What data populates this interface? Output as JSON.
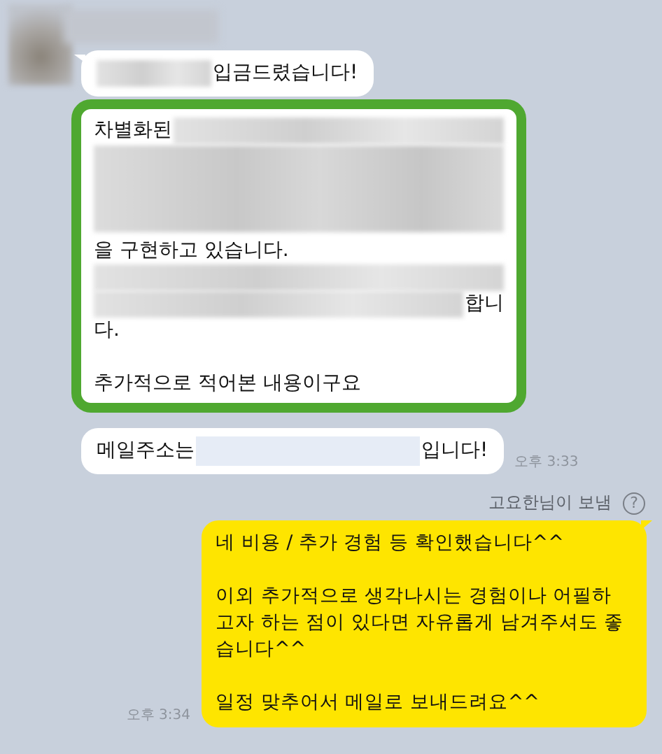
{
  "received": [
    {
      "highlighted": false,
      "lines": [
        {
          "kind": "text",
          "segments": [
            {
              "kind": "redacted"
            },
            {
              "kind": "text",
              "text": "입금드렸습니다!"
            }
          ]
        }
      ]
    },
    {
      "highlighted": true,
      "lines": [
        {
          "kind": "text",
          "segments": [
            {
              "kind": "text",
              "text": "차별화된"
            },
            {
              "kind": "redacted"
            }
          ]
        },
        {
          "kind": "redacted-tall"
        },
        {
          "kind": "text",
          "segments": [
            {
              "kind": "text",
              "text": "을 구현하고 있습니다."
            }
          ]
        },
        {
          "kind": "text",
          "segments": [
            {
              "kind": "redacted"
            }
          ]
        },
        {
          "kind": "text",
          "segments": [
            {
              "kind": "redacted"
            },
            {
              "kind": "text",
              "text": "합니"
            }
          ]
        },
        {
          "kind": "text",
          "segments": [
            {
              "kind": "text",
              "text": "다."
            }
          ]
        },
        {
          "kind": "blank"
        },
        {
          "kind": "text",
          "segments": [
            {
              "kind": "text",
              "text": "추가적으로 적어본 내용이구요"
            }
          ]
        }
      ]
    },
    {
      "highlighted": false,
      "time": "오후 3:33",
      "lines": [
        {
          "kind": "text",
          "segments": [
            {
              "kind": "text",
              "text": "메일주소는"
            },
            {
              "kind": "redacted-link"
            },
            {
              "kind": "text",
              "text": "입니다!"
            }
          ]
        }
      ]
    }
  ],
  "sent_by": {
    "label": "고요한님이 보냄",
    "help_icon": "?"
  },
  "sent": {
    "time": "오후 3:34",
    "paragraphs": [
      [
        "네 비용 / 추가 경험 등 확인했습니다^^"
      ],
      [
        "이외 추가적으로 생각나시는 경험이나 어필하",
        "고자 하는 점이 있다면 자유롭게 남겨주셔도 좋",
        "습니다^^"
      ],
      [
        "일정 맞추어서 메일로 보내드려요^^"
      ]
    ]
  }
}
